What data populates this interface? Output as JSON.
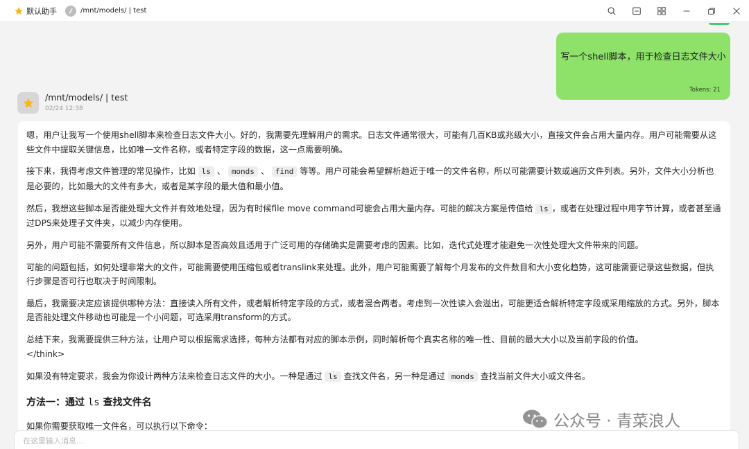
{
  "titlebar": {
    "assistant_name": "默认助手",
    "topic_title": "/mnt/models/ | test"
  },
  "user_message": {
    "text": "写一个shell脚本，用于检查日志文件大小",
    "tokens": "Tokens: 21"
  },
  "assistant_message": {
    "name": "/mnt/models/ | test",
    "time": "02/24 12:38",
    "p1": "嗯，用户让我写一个使用shell脚本来检查日志文件大小。好的，我需要先理解用户的需求。日志文件通常很大，可能有几百KB或兆级大小，直接文件会占用大量内存。用户可能需要从这些文件中提取关键信息，比如唯一文件名称，或者特定字段的数据，这一点需要明确。",
    "p2": {
      "a": "接下来，我得考虑文件管理的常见操作，比如",
      "c1": "ls",
      "s1": "、",
      "c2": "monds",
      "s2": "、",
      "c3": "find",
      "b": "等等。用户可能会希望解析趋近于唯一的文件名称，所以可能需要计数或遍历文件列表。另外，文件大小分析也是必要的，比如最大的文件有多大，或者是某字段的最大值和最小值。"
    },
    "p3": {
      "a": "然后，我想这些脚本是否能处理大文件并有效地处理，因为有时候file move command可能会占用大量内存。可能的解决方案是传值给",
      "c1": "ls",
      "b": "，或者在处理过程中用字节计算，或者甚至通过DPS来处理子文件夹，以减少内存使用。"
    },
    "p4": "另外，用户可能不需要所有文件信息，所以脚本是否高效且适用于广泛可用的存储确实是需要考虑的因素。比如，迭代式处理才能避免一次性处理大文件带来的问题。",
    "p5": "可能的问题包括，如何处理非常大的文件，可能需要使用压缩包或者translink来处理。此外，用户可能需要了解每个月发布的文件数目和大小变化趋势，这可能需要记录这些数据，但执行步骤是否可行也取决于时间限制。",
    "p6": "最后，我需要决定应该提供哪种方法：直接读入所有文件，或者解析特定字段的方式，或者混合两者。考虑到一次性读入会溢出，可能更适合解析特定字段或采用缩放的方式。另外，脚本是否能处理文件移动也可能是一个小问题，可选采用transform的方式。",
    "p7": "总结下来，我需要提供三种方法，让用户可以根据需求选择，每种方法都有对应的脚本示例，同时解析每个真实名称的唯一性、目前的最大大小以及当前字段的价值。",
    "p7_end": "</think>",
    "p8": {
      "a": "如果没有特定要求，我会为你设计两种方法来检查日志文件的大小。一种是通过",
      "c1": "ls",
      "b": "查找文件名，另一种是通过",
      "c2": "monds",
      "c": "查找当前文件大小或文件名。"
    },
    "heading": {
      "a": "方法一：通过",
      "code": "ls",
      "b": "查找文件名"
    },
    "p9": "如果你需要获取唯一文件名，可以执行以下命令："
  },
  "input": {
    "placeholder": "在这里输入消息..."
  },
  "watermark": {
    "text": "公众号 · 青菜浪人"
  },
  "colors": {
    "user_bubble": "#8ee26a",
    "accent_green": "#4cc86a",
    "background": "#f3f3f4"
  }
}
